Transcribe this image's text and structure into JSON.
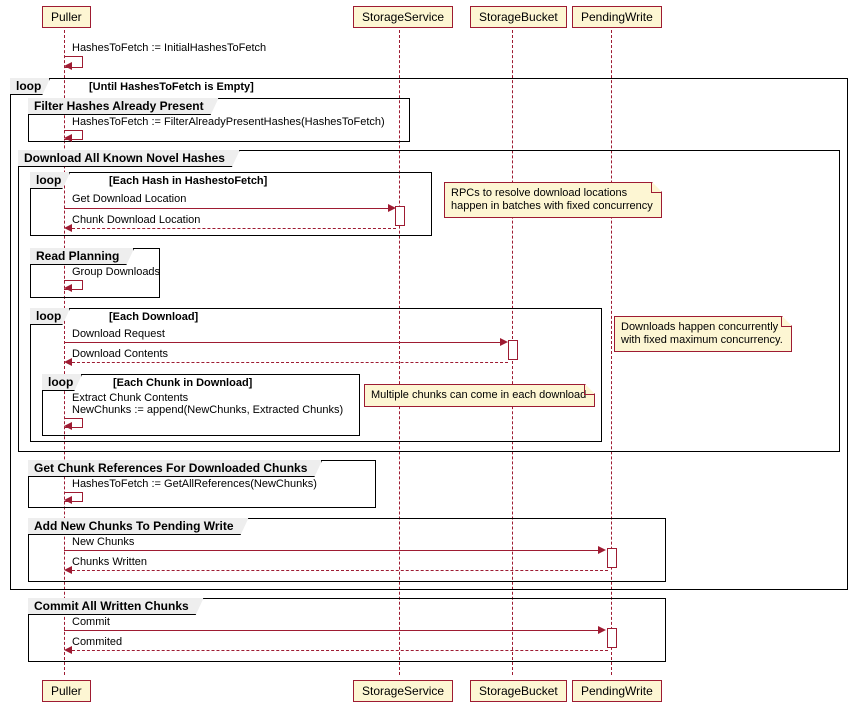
{
  "chart_data": {
    "type": "sequence-diagram",
    "participants": [
      "Puller",
      "StorageService",
      "StorageBucket",
      "PendingWrite"
    ],
    "initial_self_message": {
      "on": "Puller",
      "text": "HashesToFetch := InitialHashesToFetch"
    },
    "main_loop": {
      "operator": "loop",
      "guard": "[Until HashesToFetch is Empty]",
      "fragments": [
        {
          "title": "Filter Hashes Already Present",
          "self_message": {
            "on": "Puller",
            "text": "HashesToFetch := FilterAlreadyPresentHashes(HashesToFetch)"
          }
        },
        {
          "title": "Download All Known Novel Hashes",
          "inner_loop": {
            "operator": "loop",
            "guard": "[Each Hash in HashestoFetch]",
            "messages": [
              {
                "from": "Puller",
                "to": "StorageService",
                "text": "Get Download Location",
                "style": "solid"
              },
              {
                "from": "StorageService",
                "to": "Puller",
                "text": "Chunk Download Location",
                "style": "dashed"
              }
            ],
            "note": {
              "attached_to": "StorageService",
              "side": "right",
              "text_lines": [
                "RPCs to resolve download locations",
                "happen in batches with fixed concurrency"
              ]
            }
          },
          "read_planning": {
            "title": "Read Planning",
            "self_message": {
              "on": "Puller",
              "text": "Group Downloads"
            }
          },
          "download_loop": {
            "operator": "loop",
            "guard": "[Each Download]",
            "messages": [
              {
                "from": "Puller",
                "to": "StorageBucket",
                "text": "Download Request",
                "style": "solid"
              },
              {
                "from": "StorageBucket",
                "to": "Puller",
                "text": "Download Contents",
                "style": "dashed"
              }
            ],
            "note": {
              "attached_to": "StorageBucket",
              "side": "right",
              "text_lines": [
                "Downloads happen concurrently",
                "with fixed maximum concurrency."
              ]
            },
            "chunk_loop": {
              "operator": "loop",
              "guard": "[Each Chunk in Download]",
              "self_message": {
                "on": "Puller",
                "text_lines": [
                  "Extract Chunk Contents",
                  "NewChunks := append(NewChunks, Extracted Chunks)"
                ]
              },
              "note": {
                "side": "right",
                "text_lines": [
                  "Multiple chunks can come in each download"
                ]
              }
            }
          }
        },
        {
          "title": "Get Chunk References For Downloaded Chunks",
          "self_message": {
            "on": "Puller",
            "text": "HashesToFetch := GetAllReferences(NewChunks)"
          }
        },
        {
          "title": "Add New Chunks To Pending Write",
          "messages": [
            {
              "from": "Puller",
              "to": "PendingWrite",
              "text": "New Chunks",
              "style": "solid"
            },
            {
              "from": "PendingWrite",
              "to": "Puller",
              "text": "Chunks Written",
              "style": "dashed"
            }
          ]
        }
      ]
    },
    "commit": {
      "title": "Commit All Written Chunks",
      "messages": [
        {
          "from": "Puller",
          "to": "PendingWrite",
          "text": "Commit",
          "style": "solid"
        },
        {
          "from": "PendingWrite",
          "to": "Puller",
          "text": "Commited",
          "style": "dashed"
        }
      ]
    }
  },
  "participants": {
    "puller": "Puller",
    "storage_service": "StorageService",
    "storage_bucket": "StorageBucket",
    "pending_write": "PendingWrite"
  },
  "labels": {
    "loop": "loop",
    "main_guard": "[Until HashesToFetch is Empty]",
    "init_msg": "HashesToFetch := InitialHashesToFetch",
    "filter_title": "Filter Hashes Already Present",
    "filter_msg": "HashesToFetch := FilterAlreadyPresentHashes(HashesToFetch)",
    "dl_novel_title": "Download All Known Novel Hashes",
    "hash_loop_guard": "[Each Hash in HashestoFetch]",
    "get_dl_loc": "Get Download Location",
    "chunk_dl_loc": "Chunk Download Location",
    "note_rpc_l1": "RPCs to resolve download locations",
    "note_rpc_l2": "happen in batches with fixed concurrency",
    "read_plan_title": "Read Planning",
    "group_dl": "Group Downloads",
    "dl_loop_guard": "[Each Download]",
    "dl_req": "Download Request",
    "dl_cont": "Download Contents",
    "note_dl_l1": "Downloads happen concurrently",
    "note_dl_l2": "with fixed maximum concurrency.",
    "chunk_loop_guard": "[Each Chunk in Download]",
    "extract_l1": "Extract Chunk Contents",
    "extract_l2": "NewChunks := append(NewChunks, Extracted Chunks)",
    "note_multi": "Multiple chunks can come in each download",
    "refs_title": "Get Chunk References For Downloaded Chunks",
    "refs_msg": "HashesToFetch := GetAllReferences(NewChunks)",
    "add_title": "Add New Chunks To Pending Write",
    "new_chunks": "New Chunks",
    "chunks_written": "Chunks Written",
    "commit_title": "Commit All Written Chunks",
    "commit": "Commit",
    "committed": "Commited"
  }
}
